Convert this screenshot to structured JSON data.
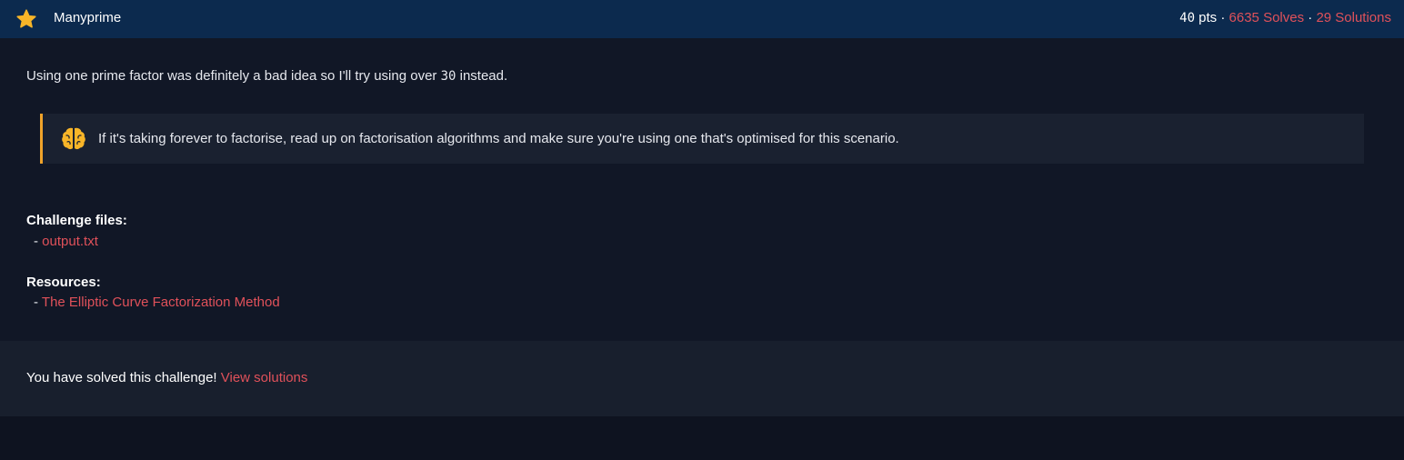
{
  "header": {
    "title": "Manyprime",
    "points_num": "40",
    "points_unit": " pts",
    "sep1": " · ",
    "solves": "6635 Solves",
    "sep2": " · ",
    "solutions": "29 Solutions",
    "star_color": "#f8b528"
  },
  "description": {
    "before": "Using one prime factor was definitely a bad idea so I'll try using over ",
    "number": "30",
    "after": " instead."
  },
  "hint": {
    "icon": "brain-icon",
    "text": "If it's taking forever to factorise, read up on factorisation algorithms and make sure you're using one that's optimised for this scenario."
  },
  "files": {
    "label": "Challenge files:",
    "dash": "- ",
    "items": [
      "output.txt"
    ]
  },
  "resources": {
    "label": "Resources:",
    "dash": "- ",
    "items": [
      "The Elliptic Curve Factorization Method"
    ]
  },
  "footer": {
    "text": "You have solved this challenge! ",
    "link": "View solutions"
  },
  "colors": {
    "accent": "#e0515a",
    "hint_border": "#f0a32a",
    "header_bg": "#0c2a4e"
  }
}
